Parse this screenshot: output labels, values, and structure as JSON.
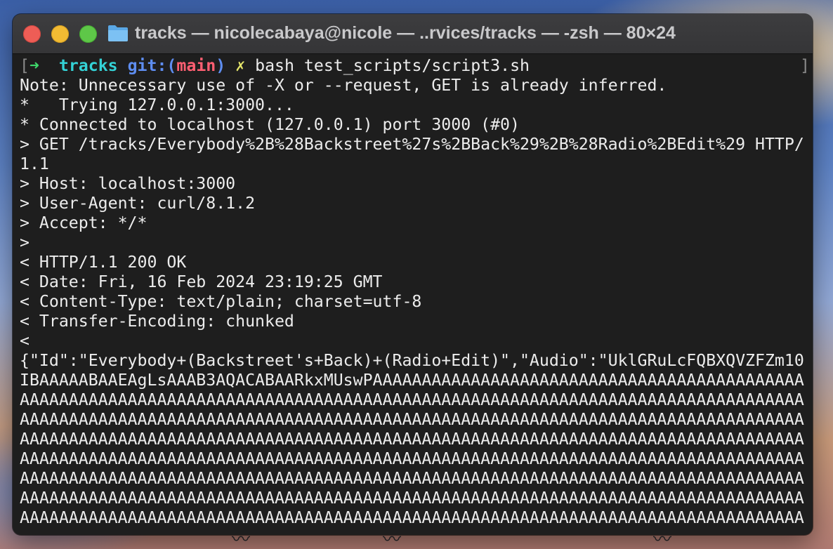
{
  "window": {
    "title": "tracks — nicolecabaya@nicole — ..rvices/tracks — -zsh — 80×24"
  },
  "prompt": {
    "left_bracket": "[",
    "arrow": "➜",
    "dir": "tracks",
    "git_label": "git:(",
    "branch": "main",
    "git_close": ")",
    "dirty": "✗",
    "command": "bash test_scripts/script3.sh",
    "right_bracket": "]"
  },
  "output_lines": [
    "Note: Unnecessary use of -X or --request, GET is already inferred.",
    "*   Trying 127.0.0.1:3000...",
    "* Connected to localhost (127.0.0.1) port 3000 (#0)",
    "> GET /tracks/Everybody%2B%28Backstreet%27s%2BBack%29%2B%28Radio%2BEdit%29 HTTP/",
    "1.1",
    "> Host: localhost:3000",
    "> User-Agent: curl/8.1.2",
    "> Accept: */*",
    ">",
    "< HTTP/1.1 200 OK",
    "< Date: Fri, 16 Feb 2024 23:19:25 GMT",
    "< Content-Type: text/plain; charset=utf-8",
    "< Transfer-Encoding: chunked",
    "<",
    "{\"Id\":\"Everybody+(Backstreet's+Back)+(Radio+Edit)\",\"Audio\":\"UklGRuLcFQBXQVZFZm10",
    "IBAAAAABAAEAgLsAAAB3AQACABAARkxMUswPAAAAAAAAAAAAAAAAAAAAAAAAAAAAAAAAAAAAAAAAAAAA",
    "AAAAAAAAAAAAAAAAAAAAAAAAAAAAAAAAAAAAAAAAAAAAAAAAAAAAAAAAAAAAAAAAAAAAAAAAAAAAAAAA",
    "AAAAAAAAAAAAAAAAAAAAAAAAAAAAAAAAAAAAAAAAAAAAAAAAAAAAAAAAAAAAAAAAAAAAAAAAAAAAAAAA",
    "AAAAAAAAAAAAAAAAAAAAAAAAAAAAAAAAAAAAAAAAAAAAAAAAAAAAAAAAAAAAAAAAAAAAAAAAAAAAAAAA",
    "AAAAAAAAAAAAAAAAAAAAAAAAAAAAAAAAAAAAAAAAAAAAAAAAAAAAAAAAAAAAAAAAAAAAAAAAAAAAAAAA",
    "AAAAAAAAAAAAAAAAAAAAAAAAAAAAAAAAAAAAAAAAAAAAAAAAAAAAAAAAAAAAAAAAAAAAAAAAAAAAAAAA",
    "AAAAAAAAAAAAAAAAAAAAAAAAAAAAAAAAAAAAAAAAAAAAAAAAAAAAAAAAAAAAAAAAAAAAAAAAAAAAAAAA",
    "AAAAAAAAAAAAAAAAAAAAAAAAAAAAAAAAAAAAAAAAAAAAAAAAAAAAAAAAAAAAAAAAAAAAAAAAAAAAAAAA"
  ],
  "colors": {
    "terminal_bg": "#1e1e1e",
    "text": "#ececec",
    "arrow": "#3fd86b",
    "dir": "#34d2d6",
    "git": "#5e8df0",
    "branch": "#ff5f72",
    "dirty": "#e4e56a"
  },
  "icons": {
    "window_controls": [
      "close-button",
      "minimize-button",
      "zoom-button"
    ],
    "title_icon": "folder-icon"
  }
}
